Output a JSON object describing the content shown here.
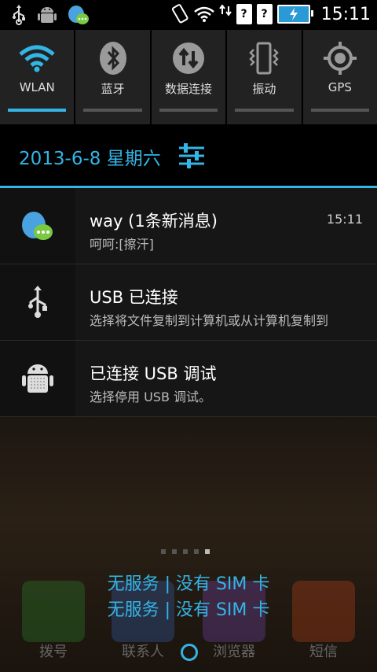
{
  "statusbar": {
    "time": "15:11",
    "left_icons": [
      "usb-icon",
      "android-debug-icon",
      "chat-app-icon"
    ],
    "right_icons": [
      "vibrate-icon",
      "wifi-icon",
      "data-arrows-icon",
      "no-sim-icon",
      "no-sim-icon",
      "battery-charging-icon"
    ],
    "qmark": "?"
  },
  "quick_settings": [
    {
      "label": "WLAN",
      "icon": "wifi-icon",
      "on": true
    },
    {
      "label": "蓝牙",
      "icon": "bluetooth-icon",
      "on": false
    },
    {
      "label": "数据连接",
      "icon": "data-connection-icon",
      "on": false
    },
    {
      "label": "振动",
      "icon": "vibrate-icon",
      "on": false
    },
    {
      "label": "GPS",
      "icon": "gps-icon",
      "on": false
    }
  ],
  "date": "2013-6-8 星期六",
  "notifications": [
    {
      "title": "way (1条新消息)",
      "subtitle": "呵呵:[擦汗]",
      "time": "15:11",
      "icon": "chat-app-icon"
    },
    {
      "title": "USB 已连接",
      "subtitle": "选择将文件复制到计算机或从计算机复制到",
      "time": "",
      "icon": "usb-icon"
    },
    {
      "title": "已连接 USB 调试",
      "subtitle": "选择停用 USB 调试。",
      "time": "",
      "icon": "android-debug-icon"
    }
  ],
  "lockscreen": {
    "no_service_line1": "无服务 | 没有 SIM 卡",
    "no_service_line2": "无服务 | 没有 SIM 卡",
    "page_dots": 5,
    "active_dot": 4
  },
  "dock": {
    "apps": [
      {
        "label": "拨号",
        "color": "#2e9a2e"
      },
      {
        "label": "联系人",
        "color": "#3a6fd0"
      },
      {
        "label": "浏览器",
        "color": "#8a4fd0"
      },
      {
        "label": "短信",
        "color": "#e04a1a"
      }
    ]
  },
  "colors": {
    "accent": "#33b5e5"
  }
}
